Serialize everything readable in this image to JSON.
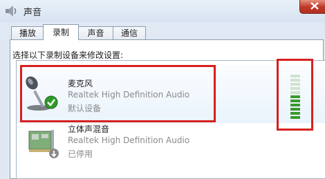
{
  "window": {
    "title": "声音"
  },
  "tabs": [
    {
      "label": "播放"
    },
    {
      "label": "录制"
    },
    {
      "label": "声音"
    },
    {
      "label": "通信"
    }
  ],
  "instruction": "选择以下录制设备来修改设置:",
  "devices": [
    {
      "name": "麦克风",
      "description": "Realtek High Definition Audio",
      "status": "默认设备",
      "icon": "microphone-icon",
      "badge": "checkmark-icon"
    },
    {
      "name": "立体声混音",
      "description": "Realtek High Definition Audio",
      "status": "已停用",
      "icon": "sound-card-icon",
      "badge": "disabled-arrow-icon"
    }
  ],
  "level_meter": {
    "segments": 11,
    "lit_segments": 6,
    "lit_color": "#3a9a2e",
    "unlit_color": "#cfe3cf"
  },
  "colors": {
    "highlight": "#d61f1f",
    "selection": "#eaf3fc"
  }
}
